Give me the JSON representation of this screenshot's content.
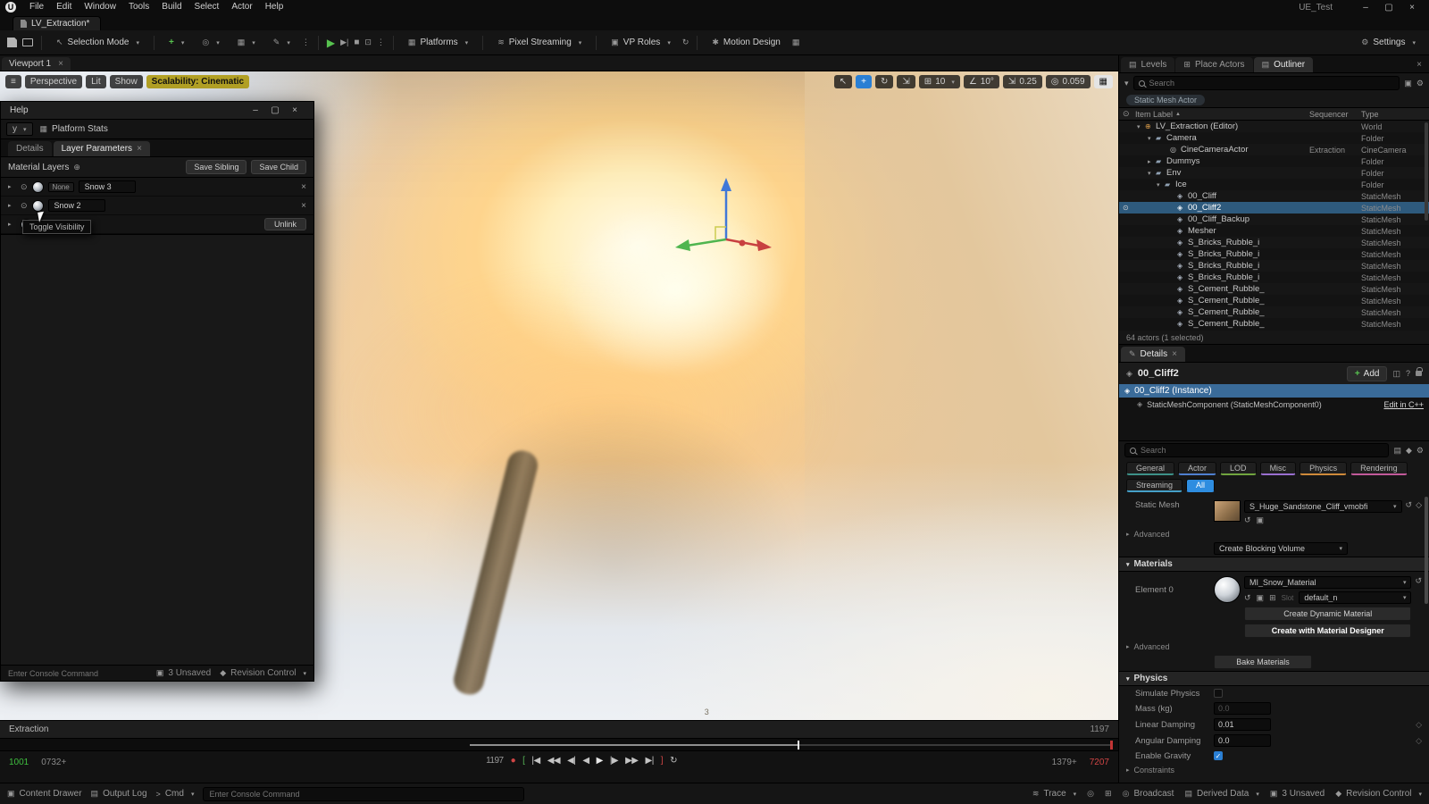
{
  "icons": {
    "caret_down": "▾",
    "caret_right": "▸",
    "sort_asc": "▲",
    "close": "×",
    "minimize": "–",
    "maximize": "▢",
    "hamburger": "≡",
    "kebab": "⋮",
    "eye": "⊙",
    "check": "✓",
    "plus_circle": "⊕",
    "play": "▶",
    "play_next": "▶|",
    "stop": "■",
    "detach": "⊡",
    "cursor": "↖",
    "move": "+",
    "rotate": "↻",
    "scale": "⇲",
    "grid": "⊞",
    "angle": "∠",
    "cam": "◎",
    "viewgrid": "▦",
    "undo": "↺",
    "diamond": "◇",
    "browse": "▣",
    "gear": "⚙",
    "pulse": "≋",
    "doc": "▤",
    "star": "◆",
    "question": "?",
    "panes": "◫",
    "pen": "✎",
    "spark": "✱",
    "prompt": ">",
    "mesh": "◈",
    "record": "●"
  },
  "window": {
    "logo": "U",
    "project": "UE_Test"
  },
  "menu": {
    "items": [
      {
        "label": "File"
      },
      {
        "label": "Edit"
      },
      {
        "label": "Window"
      },
      {
        "label": "Tools"
      },
      {
        "label": "Build"
      },
      {
        "label": "Select"
      },
      {
        "label": "Actor"
      },
      {
        "label": "Help"
      }
    ]
  },
  "tabbar": {
    "tab": "LV_Extraction*"
  },
  "toolbar": {
    "selection_mode": "Selection Mode",
    "platforms": "Platforms",
    "pixel_streaming": "Pixel Streaming",
    "vp_roles": "VP Roles",
    "motion_design": "Motion Design",
    "settings": "Settings"
  },
  "viewport": {
    "tab": "Viewport 1",
    "perspective": "Perspective",
    "lit": "Lit",
    "show": "Show",
    "scalability": "Scalability: Cinematic",
    "snap_grid": "10",
    "snap_rotate": "10°",
    "snap_scale": "0.25",
    "cam_speed": "0.059",
    "bottom_label": "3"
  },
  "help_window": {
    "title": "Help",
    "filter_stub": "y",
    "platform_stats": "Platform Stats",
    "tab_details": "Details",
    "tab_layer_params": "Layer Parameters",
    "material_layers": "Material Layers",
    "save_sibling": "Save Sibling",
    "save_child": "Save Child",
    "layers": [
      {
        "badge": "None",
        "name": "Snow 3"
      },
      {
        "badge": "",
        "name": "Snow 2"
      }
    ],
    "unlink": "Unlink",
    "tooltip": "Toggle Visibility",
    "console_placeholder": "Enter Console Command",
    "unsaved": "3 Unsaved",
    "revision": "Revision Control"
  },
  "outliner": {
    "tab_levels": "Levels",
    "tab_place_actors": "Place Actors",
    "tab_outliner": "Outliner",
    "search_placeholder": "Search",
    "filter_chip": "Static Mesh Actor",
    "col_item": "Item Label",
    "col_seq": "Sequencer",
    "col_type": "Type",
    "rows": [
      {
        "indent": 2,
        "arrow": "▾",
        "icon": "⊕",
        "ic": "#d89b4a",
        "label": "LV_Extraction (Editor)",
        "seq": "",
        "type": "World",
        "eye": ""
      },
      {
        "indent": 14,
        "arrow": "▾",
        "icon": "▰",
        "ic": "#8fa0b2",
        "label": "Camera",
        "seq": "",
        "type": "Folder",
        "eye": ""
      },
      {
        "indent": 30,
        "arrow": "",
        "icon": "◎",
        "ic": "#c0c0c0",
        "label": "CineCameraActor",
        "seq": "Extraction",
        "type": "CineCamera",
        "eye": ""
      },
      {
        "indent": 14,
        "arrow": "▸",
        "icon": "▰",
        "ic": "#8fa0b2",
        "label": "Dummys",
        "seq": "",
        "type": "Folder",
        "eye": ""
      },
      {
        "indent": 14,
        "arrow": "▾",
        "icon": "▰",
        "ic": "#8fa0b2",
        "label": "Env",
        "seq": "",
        "type": "Folder",
        "eye": ""
      },
      {
        "indent": 24,
        "arrow": "▾",
        "icon": "▰",
        "ic": "#8fa0b2",
        "label": "Ice",
        "seq": "",
        "type": "Folder",
        "eye": ""
      },
      {
        "indent": 38,
        "arrow": "",
        "icon": "◈",
        "ic": "#aab2be",
        "label": "00_Cliff",
        "seq": "",
        "type": "StaticMesh",
        "eye": ""
      },
      {
        "indent": 38,
        "arrow": "",
        "icon": "◈",
        "ic": "#e8eef4",
        "label": "00_Cliff2",
        "seq": "",
        "type": "StaticMesh",
        "selected": true,
        "eye": "⊙"
      },
      {
        "indent": 38,
        "arrow": "",
        "icon": "◈",
        "ic": "#aab2be",
        "label": "00_Cliff_Backup",
        "seq": "",
        "type": "StaticMesh",
        "eye": ""
      },
      {
        "indent": 38,
        "arrow": "",
        "icon": "◈",
        "ic": "#aab2be",
        "label": "Mesher",
        "seq": "",
        "type": "StaticMesh",
        "eye": ""
      },
      {
        "indent": 38,
        "arrow": "",
        "icon": "◈",
        "ic": "#aab2be",
        "label": "S_Bricks_Rubble_i",
        "seq": "",
        "type": "StaticMesh",
        "eye": ""
      },
      {
        "indent": 38,
        "arrow": "",
        "icon": "◈",
        "ic": "#aab2be",
        "label": "S_Bricks_Rubble_i",
        "seq": "",
        "type": "StaticMesh",
        "eye": ""
      },
      {
        "indent": 38,
        "arrow": "",
        "icon": "◈",
        "ic": "#aab2be",
        "label": "S_Bricks_Rubble_i",
        "seq": "",
        "type": "StaticMesh",
        "eye": ""
      },
      {
        "indent": 38,
        "arrow": "",
        "icon": "◈",
        "ic": "#aab2be",
        "label": "S_Bricks_Rubble_i",
        "seq": "",
        "type": "StaticMesh",
        "eye": ""
      },
      {
        "indent": 38,
        "arrow": "",
        "icon": "◈",
        "ic": "#aab2be",
        "label": "S_Cement_Rubble_",
        "seq": "",
        "type": "StaticMesh",
        "eye": ""
      },
      {
        "indent": 38,
        "arrow": "",
        "icon": "◈",
        "ic": "#aab2be",
        "label": "S_Cement_Rubble_",
        "seq": "",
        "type": "StaticMesh",
        "eye": ""
      },
      {
        "indent": 38,
        "arrow": "",
        "icon": "◈",
        "ic": "#aab2be",
        "label": "S_Cement_Rubble_",
        "seq": "",
        "type": "StaticMesh",
        "eye": ""
      },
      {
        "indent": 38,
        "arrow": "",
        "icon": "◈",
        "ic": "#aab2be",
        "label": "S_Cement_Rubble_",
        "seq": "",
        "type": "StaticMesh",
        "eye": ""
      }
    ],
    "status": "64 actors (1 selected)"
  },
  "details": {
    "tab": "Details",
    "actor_name": "00_Cliff2",
    "add_button": "Add",
    "instance": "00_Cliff2 (Instance)",
    "component": "StaticMeshComponent (StaticMeshComponent0)",
    "edit_cpp": "Edit in C++",
    "search_placeholder": "Search",
    "chips": [
      {
        "label": "General",
        "uc": "#3d9188"
      },
      {
        "label": "Actor",
        "uc": "#4f7fd0"
      },
      {
        "label": "LOD",
        "uc": "#71a53f"
      },
      {
        "label": "Misc",
        "uc": "#9a6fd0"
      },
      {
        "label": "Physics",
        "uc": "#cf8a3a"
      },
      {
        "label": "Rendering",
        "uc": "#c25a9a"
      },
      {
        "label": "Streaming",
        "uc": "#45a0c8"
      },
      {
        "label": "All",
        "active": true
      }
    ],
    "static_mesh_label": "Static Mesh",
    "static_mesh_value": "S_Huge_Sandstone_Cliff_vmobfi",
    "advanced": "Advanced",
    "blocking_volume": "Create Blocking Volume",
    "materials": "Materials",
    "element0": "Element 0",
    "material_value": "MI_Snow_Material",
    "slot_label": "Slot",
    "slot_value": "default_n",
    "create_dynamic": "Create Dynamic Material",
    "create_designer": "Create with Material Designer",
    "bake": "Bake Materials",
    "physics": "Physics",
    "simulate_physics": "Simulate Physics",
    "mass_label": "Mass (kg)",
    "mass_value": "0.0",
    "linear_label": "Linear Damping",
    "linear_value": "0.01",
    "angular_label": "Angular Damping",
    "angular_value": "0.0",
    "gravity_label": "Enable Gravity",
    "constraints": "Constraints"
  },
  "sequencer": {
    "name": "Extraction",
    "frame_right": "1197",
    "start": "1001",
    "mark_in": "0732+",
    "mark_out": "1379+",
    "end": "7207",
    "transport": [
      {
        "g": "1197",
        "color": "#9a9a9a"
      },
      {
        "g": "●",
        "color": "#d04545"
      },
      {
        "g": "[",
        "color": "#55b355"
      },
      {
        "g": "|◀",
        "color": "#c4c4c4"
      },
      {
        "g": "◀◀",
        "color": "#c4c4c4"
      },
      {
        "g": "◀|",
        "color": "#c4c4c4"
      },
      {
        "g": "◀",
        "color": "#c4c4c4"
      },
      {
        "g": "▶",
        "color": "#e8e8e8"
      },
      {
        "g": "|▶",
        "color": "#c4c4c4"
      },
      {
        "g": "▶▶",
        "color": "#c4c4c4"
      },
      {
        "g": "▶|",
        "color": "#c4c4c4"
      },
      {
        "g": "]",
        "color": "#d04545"
      },
      {
        "g": "↻",
        "color": "#c4c4c4"
      }
    ]
  },
  "statusbar": {
    "content_drawer": "Content Drawer",
    "output_log": "Output Log",
    "cmd": "Cmd",
    "console_placeholder": "Enter Console Command",
    "trace": "Trace",
    "broadcast": "Broadcast",
    "derived_data": "Derived Data",
    "unsaved": "3 Unsaved",
    "revision": "Revision Control"
  }
}
